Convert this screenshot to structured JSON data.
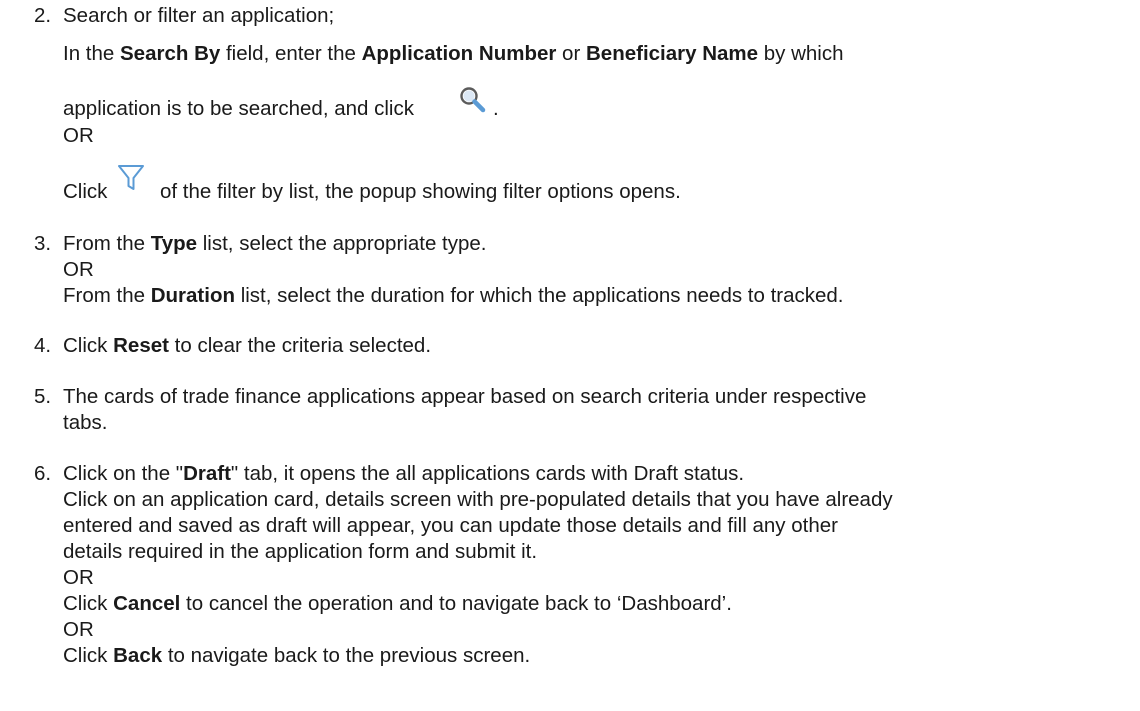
{
  "step2": {
    "number": "2.",
    "line1": "Search or filter an application;",
    "line2": {
      "t1": "In the ",
      "b1": "Search By",
      "t2": " field, enter the ",
      "b2": "Application Number",
      "t3": " or ",
      "b3": "Beneficiary Name",
      "t4": " by which"
    },
    "line3": {
      "t1": "application is to be searched, and click",
      "t2": "."
    },
    "or": "OR",
    "line5": {
      "t1": "Click",
      "t2": "of the filter by list, the popup showing filter options opens."
    },
    "search_icon": "search-icon",
    "filter_icon": "filter-funnel-icon"
  },
  "step3": {
    "number": "3.",
    "line1": {
      "t1": "From the ",
      "b1": "Type",
      "t2": " list, select the appropriate type."
    },
    "or": "OR",
    "line3": {
      "t1": "From the ",
      "b1": "Duration",
      "t2": " list, select the duration for which the applications needs to tracked."
    }
  },
  "step4": {
    "number": "4.",
    "line1": {
      "t1": "Click ",
      "b1": "Reset",
      "t2": " to clear the criteria selected."
    }
  },
  "step5": {
    "number": "5.",
    "line1": "The cards of trade finance applications appear based on search criteria under respective",
    "line2": "tabs."
  },
  "step6": {
    "number": "6.",
    "line1": {
      "t1": "Click on the \"",
      "b1": "Draft",
      "t2": "\" tab, it opens the all applications cards with Draft status."
    },
    "line2": "Click on an application card, details screen with pre-populated details that you have already",
    "line3": "entered and saved as draft will appear, you can update those details and fill any other",
    "line4": "details required in the application form and submit it.",
    "or1": "OR",
    "line6": {
      "t1": "Click ",
      "b1": "Cancel",
      "t2": " to cancel the operation and to navigate back to ‘Dashboard’."
    },
    "or2": "OR",
    "line8": {
      "t1": "Click ",
      "b1": "Back",
      "t2": " to navigate back to the previous screen."
    }
  },
  "colors": {
    "text": "#1a1a1a",
    "icon_blue": "#5b9bd5",
    "icon_gray": "#555555"
  }
}
